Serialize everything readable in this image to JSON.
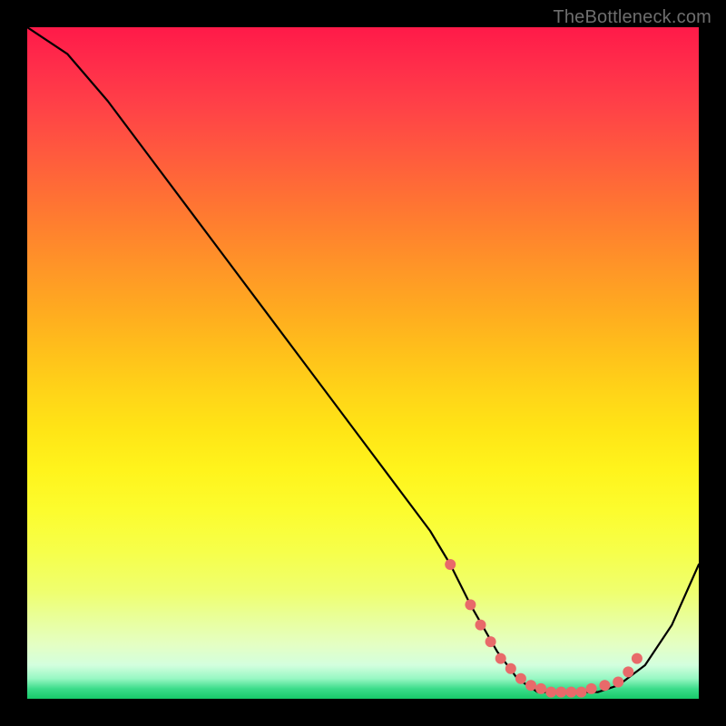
{
  "watermark": "TheBottleneck.com",
  "chart_data": {
    "type": "line",
    "title": "",
    "xlabel": "",
    "ylabel": "",
    "xlim": [
      0,
      100
    ],
    "ylim": [
      0,
      100
    ],
    "grid": false,
    "series": [
      {
        "name": "curve",
        "color": "#000000",
        "x": [
          0,
          6,
          12,
          18,
          24,
          30,
          36,
          42,
          48,
          54,
          60,
          63,
          66,
          70,
          73,
          76,
          79,
          82,
          85,
          88,
          92,
          96,
          100
        ],
        "values": [
          100,
          96,
          89,
          81,
          73,
          65,
          57,
          49,
          41,
          33,
          25,
          20,
          14,
          7,
          3,
          1,
          1,
          1,
          1,
          2,
          5,
          11,
          20
        ]
      }
    ],
    "markers": {
      "name": "highlight-points",
      "color": "#e86a6a",
      "radius_px": 6,
      "x": [
        63,
        66,
        67.5,
        69,
        70.5,
        72,
        73.5,
        75,
        76.5,
        78,
        79.5,
        81,
        82.5,
        84,
        86,
        88,
        89.5,
        90.8
      ],
      "values": [
        20,
        14,
        11,
        8.5,
        6,
        4.5,
        3,
        2,
        1.5,
        1,
        1,
        1,
        1,
        1.5,
        2,
        2.5,
        4,
        6
      ]
    }
  }
}
